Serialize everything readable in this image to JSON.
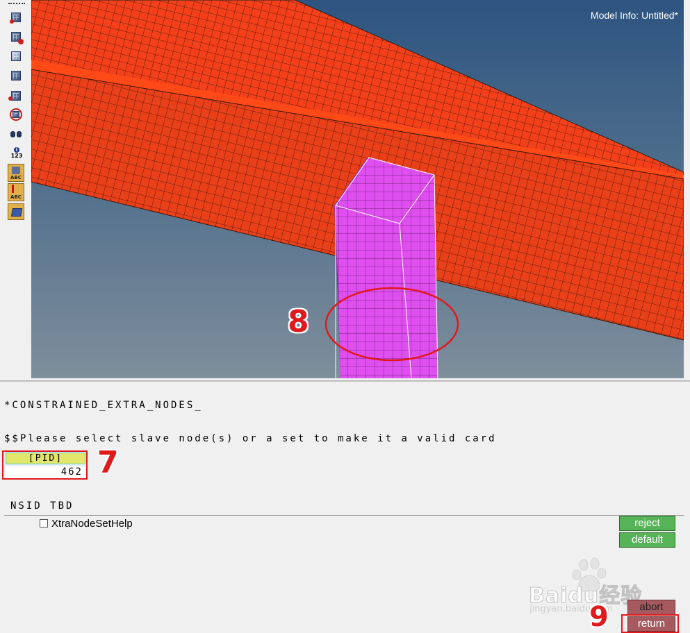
{
  "viewport": {
    "model_info": "Model Info: Untitled*",
    "colors": {
      "flange": "#f3401a",
      "column": "#df4ff0",
      "mesh_line": "#3a1407"
    }
  },
  "toolbar": {
    "icons": [
      "mesh-display-icon",
      "mesh-edit-icon",
      "mesh-view-icon",
      "mesh-shade-icon",
      "mesh-select-icon",
      "target-mesh-icon",
      "find-binoculars-icon",
      "info-123-icon",
      "label-abc-icon",
      "label-abc-down-icon",
      "quad-element-icon"
    ],
    "info_label": "123",
    "abc_label": "ABC"
  },
  "panel": {
    "card_title": "*CONSTRAINED_EXTRA_NODES_",
    "prompt": "$$Please select slave node(s) or a set to make it a valid card",
    "pid_label": "[PID]",
    "pid_value": "462",
    "nsid_label": "NSID TBD",
    "checkbox_label": "XtraNodeSetHelp",
    "buttons": {
      "reject": "reject",
      "default": "default",
      "abort": "abort",
      "return": "return"
    }
  },
  "annotations": {
    "step7": "7",
    "step8": "8",
    "step9": "9",
    "accent": "#e0191c"
  },
  "watermark": {
    "brand": "Baidu经验",
    "url": "jingyan.baidu.com"
  }
}
